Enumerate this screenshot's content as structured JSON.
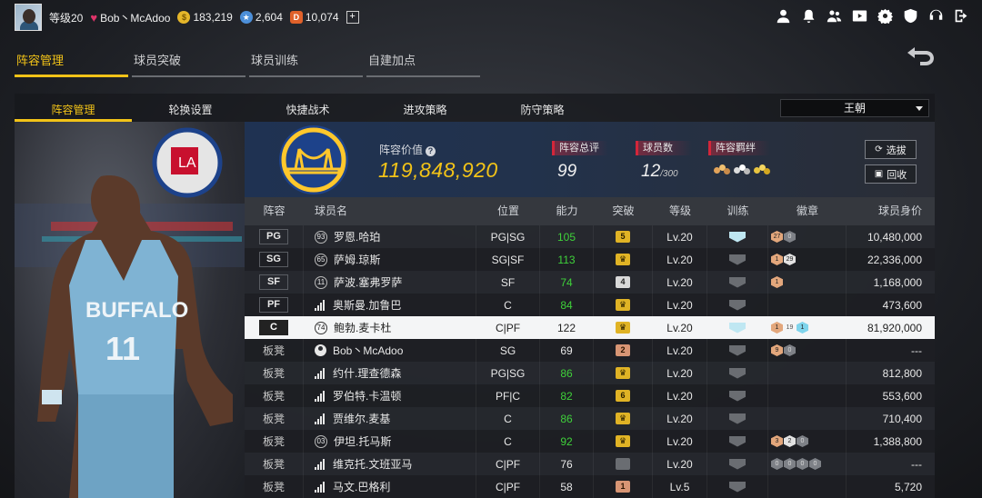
{
  "topbar": {
    "level": "等级20",
    "username": "Bob丶McAdoo",
    "gold": "183,219",
    "stars": "2,604",
    "diamonds": "10,074",
    "plus": "+"
  },
  "main_tabs": [
    "阵容管理",
    "球员突破",
    "球员训练",
    "自建加点"
  ],
  "sub_tabs": [
    "阵容管理",
    "轮换设置",
    "快捷战术",
    "进攻策略",
    "防守策略"
  ],
  "dropdown": {
    "selected": "王朝"
  },
  "header": {
    "value_label": "阵容价值",
    "help": "?",
    "value": "119,848,920",
    "rating_label": "阵容总评",
    "rating": "99",
    "count_label": "球员数",
    "count": "12",
    "count_max": "/300",
    "bond_label": "阵容羁绊",
    "select_btn": "选拔",
    "recycle_btn": "回收"
  },
  "columns": [
    "阵容",
    "球员名",
    "位置",
    "能力",
    "突破",
    "等级",
    "训练",
    "徽章",
    "球员身价"
  ],
  "rows": [
    {
      "pos": "PG",
      "num": "93",
      "name": "罗恩.哈珀",
      "role": "PG|SG",
      "ability": "105",
      "green": true,
      "brk": "5",
      "brkc": "gold",
      "lvl": "Lv.20",
      "train": true,
      "badges": [
        {
          "t": "27",
          "c": "b"
        },
        {
          "t": "0",
          "c": "d"
        }
      ],
      "value": "10,480,000"
    },
    {
      "pos": "SG",
      "num": "65",
      "name": "萨姆.琼斯",
      "role": "SG|SF",
      "ability": "113",
      "green": true,
      "brk": "♛",
      "brkc": "gold",
      "lvl": "Lv.20",
      "train": false,
      "badges": [
        {
          "t": "1",
          "c": "b"
        },
        {
          "t": "29",
          "c": "s"
        }
      ],
      "value": "22,336,000"
    },
    {
      "pos": "SF",
      "num": "11",
      "name": "萨波.塞弗罗萨",
      "role": "SF",
      "ability": "74",
      "green": true,
      "brk": "4",
      "brkc": "silver",
      "lvl": "Lv.20",
      "train": false,
      "badges": [
        {
          "t": "1",
          "c": "b"
        }
      ],
      "value": "1,168,000"
    },
    {
      "pos": "PF",
      "num": "",
      "name": "奥斯曼.加鲁巴",
      "role": "C",
      "ability": "84",
      "green": true,
      "brk": "♛",
      "brkc": "gold",
      "lvl": "Lv.20",
      "train": false,
      "badges": [],
      "value": "473,600",
      "icon": "bars"
    },
    {
      "pos": "C",
      "num": "74",
      "name": "鲍勃.麦卡杜",
      "role": "C|PF",
      "ability": "122",
      "green": false,
      "brk": "♛",
      "brkc": "gold",
      "lvl": "Lv.20",
      "train": true,
      "badges": [
        {
          "t": "1",
          "c": "b"
        },
        {
          "t": "19",
          "c": "plain"
        },
        {
          "t": "1",
          "c": "c"
        }
      ],
      "value": "81,920,000",
      "sel": true
    },
    {
      "pos": "板凳",
      "num": "",
      "name": "Bob丶McAdoo",
      "role": "SG",
      "ability": "69",
      "green": false,
      "brk": "2",
      "brkc": "bronze",
      "lvl": "Lv.20",
      "train": false,
      "badges": [
        {
          "t": "9",
          "c": "b"
        },
        {
          "t": "0",
          "c": "d"
        }
      ],
      "value": "---",
      "icon": "person"
    },
    {
      "pos": "板凳",
      "num": "",
      "name": "约什.理查德森",
      "role": "PG|SG",
      "ability": "86",
      "green": true,
      "brk": "♛",
      "brkc": "gold",
      "lvl": "Lv.20",
      "train": false,
      "badges": [],
      "value": "812,800",
      "icon": "bars"
    },
    {
      "pos": "板凳",
      "num": "",
      "name": "罗伯特.卡温顿",
      "role": "PF|C",
      "ability": "82",
      "green": true,
      "brk": "6",
      "brkc": "gold",
      "lvl": "Lv.20",
      "train": false,
      "badges": [],
      "value": "553,600",
      "icon": "bars"
    },
    {
      "pos": "板凳",
      "num": "",
      "name": "贾维尔.麦基",
      "role": "C",
      "ability": "86",
      "green": true,
      "brk": "♛",
      "brkc": "gold",
      "lvl": "Lv.20",
      "train": false,
      "badges": [],
      "value": "710,400",
      "icon": "bars"
    },
    {
      "pos": "板凳",
      "num": "03",
      "name": "伊坦.托马斯",
      "role": "C",
      "ability": "92",
      "green": true,
      "brk": "♛",
      "brkc": "gold",
      "lvl": "Lv.20",
      "train": false,
      "badges": [
        {
          "t": "3",
          "c": "b"
        },
        {
          "t": "2",
          "c": "s"
        },
        {
          "t": "0",
          "c": "d"
        }
      ],
      "value": "1,388,800"
    },
    {
      "pos": "板凳",
      "num": "",
      "name": "维克托.文班亚马",
      "role": "C|PF",
      "ability": "76",
      "green": false,
      "brk": "",
      "brkc": "grey",
      "lvl": "Lv.20",
      "train": false,
      "badges": [
        {
          "t": "0",
          "c": "d"
        },
        {
          "t": "0",
          "c": "d"
        },
        {
          "t": "0",
          "c": "d"
        },
        {
          "t": "0",
          "c": "d"
        }
      ],
      "value": "---",
      "icon": "bars"
    },
    {
      "pos": "板凳",
      "num": "",
      "name": "马文.巴格利",
      "role": "C|PF",
      "ability": "58",
      "green": false,
      "brk": "1",
      "brkc": "bronze",
      "lvl": "Lv.5",
      "train": false,
      "badges": [],
      "value": "5,720",
      "icon": "bars"
    }
  ],
  "art": {
    "jersey_team": "BUFFALO",
    "jersey_number": "11"
  },
  "colors": {
    "accent": "#f2c318",
    "green": "#3fd13a",
    "red": "#d3263a"
  }
}
